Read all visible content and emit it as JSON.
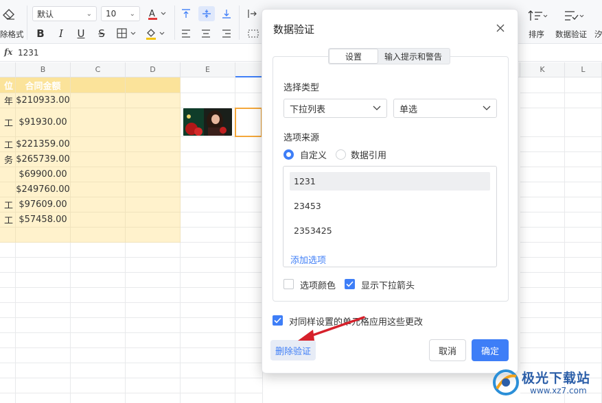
{
  "toolbar": {
    "clear_format_label": "除格式",
    "font_name": "默认",
    "font_size": "10",
    "sort_label": "排序",
    "data_validation_label": "数据验证",
    "edge_label": "汐"
  },
  "formula_bar": {
    "fx_label": "fx",
    "value": "1231"
  },
  "columns": [
    "B",
    "C",
    "D",
    "E",
    "K",
    "L"
  ],
  "sheet": {
    "header_partial_a": "位",
    "header_b": "合同金额",
    "rows": [
      {
        "a": "年",
        "b": "$210933.00"
      },
      {
        "a": "工",
        "b": "$91930.00"
      },
      {
        "a": "工",
        "b": "$221359.00"
      },
      {
        "a": "务",
        "b": "$265739.00"
      },
      {
        "a": "",
        "b": "$69900.00"
      },
      {
        "a": "",
        "b": "$249760.00"
      },
      {
        "a": "工",
        "b": "$97609.00"
      },
      {
        "a": "工",
        "b": "$57458.00"
      }
    ]
  },
  "dialog": {
    "title": "数据验证",
    "tabs": [
      "设置",
      "输入提示和警告"
    ],
    "select_type_label": "选择类型",
    "type_value": "下拉列表",
    "mode_value": "单选",
    "source_label": "选项来源",
    "radio_custom": "自定义",
    "radio_reference": "数据引用",
    "options": [
      "1231",
      "23453",
      "2353425"
    ],
    "add_option": "添加选项",
    "option_color_label": "选项颜色",
    "show_arrow_label": "显示下拉箭头",
    "apply_same_label": "对同样设置的单元格应用这些更改",
    "delete_button": "删除验证",
    "cancel_button": "取消",
    "ok_button": "确定"
  },
  "watermark": {
    "text": "极光下载站",
    "url": "www.xz7.com"
  },
  "colors": {
    "accent": "#3e7ef7",
    "yellow_fill": "#fff2cc",
    "active_cell_border": "#f4a73a",
    "annotation_arrow": "#d6212b"
  }
}
